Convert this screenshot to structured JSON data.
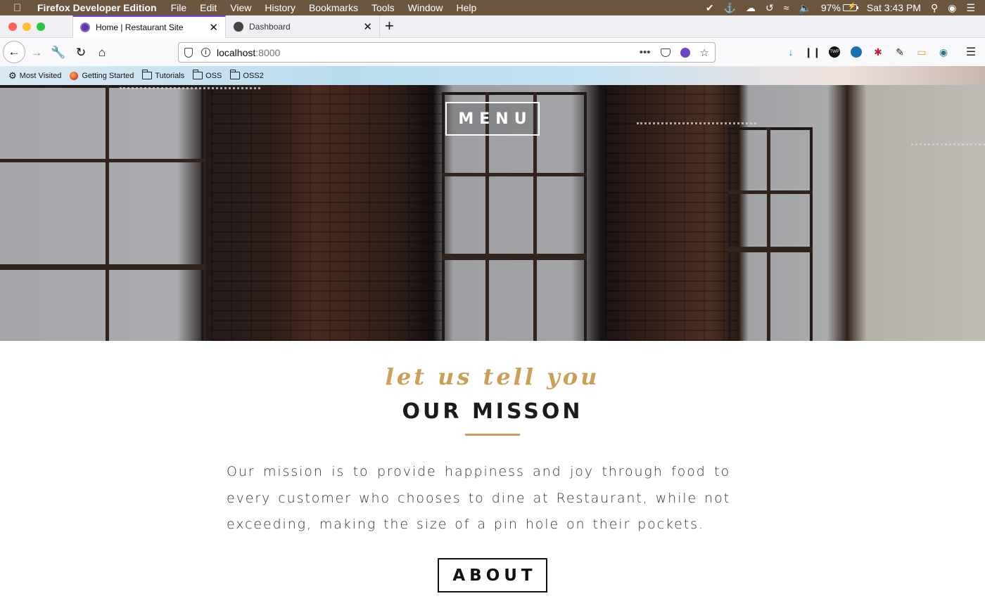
{
  "os_menubar": {
    "app_name": "Firefox Developer Edition",
    "menus": [
      "File",
      "Edit",
      "View",
      "History",
      "Bookmarks",
      "Tools",
      "Window",
      "Help"
    ],
    "battery": "97%",
    "clock": "Sat 3:43 PM"
  },
  "tabs": [
    {
      "title": "Home | Restaurant Site",
      "active": true
    },
    {
      "title": "Dashboard",
      "active": false
    }
  ],
  "urlbar": {
    "host": "localhost",
    "port": ":8000"
  },
  "bookmarks": [
    {
      "label": "Most Visited",
      "icon": "gear-icon"
    },
    {
      "label": "Getting Started",
      "icon": "firefox-icon"
    },
    {
      "label": "Tutorials",
      "icon": "folder-icon"
    },
    {
      "label": "OSS",
      "icon": "folder-icon"
    },
    {
      "label": "OSS2",
      "icon": "folder-icon"
    }
  ],
  "hero": {
    "menu_label": "MENU"
  },
  "mission": {
    "subtitle": "let us tell you",
    "title": "OUR MISSON",
    "body": "Our mission is to provide happiness and joy through food to every customer who chooses to dine at Restaurant, while not exceeding, making the size of a pin hole on their pockets.",
    "about_label": "ABOUT"
  },
  "colors": {
    "accent_gold": "#c9a056",
    "menubar_bg": "#6d5640"
  }
}
